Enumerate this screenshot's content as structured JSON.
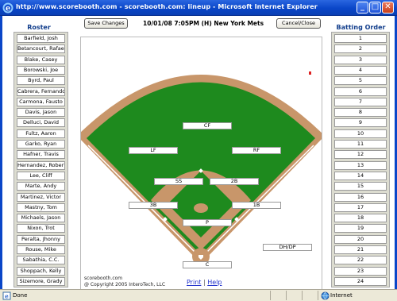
{
  "window": {
    "title": "http://www.scorebooth.com - scorebooth.com: lineup - Microsoft Internet Explorer",
    "min_glyph": "_",
    "max_glyph": "□",
    "close_glyph": "✕"
  },
  "toolbar": {
    "save_label": "Save Changes",
    "game_info": "10/01/08 7:05PM (H) New York Mets",
    "cancel_label": "Cancel/Close"
  },
  "roster": {
    "header": "Roster",
    "players": [
      "Barfield, Josh",
      "Betancourt, Rafael",
      "Blake, Casey",
      "Borowski, Joe",
      "Byrd, Paul",
      "Cabrera, Fernando",
      "Carmona, Fausto",
      "Davis, Jason",
      "Delluci, David",
      "Fultz, Aaron",
      "Garko, Ryan",
      "Hafner, Travis",
      "Hernandez, Roberto",
      "Lee, Cliff",
      "Marte, Andy",
      "Martinez, Victor",
      "Mastny, Tom",
      "Michaels, Jason",
      "Nixon, Trot",
      "Peralta, Jhonny",
      "Rouse, Mike",
      "Sabathia, C.C.",
      "Shoppach, Kelly",
      "Sizemore, Grady"
    ]
  },
  "batting_order": {
    "header": "Batting Order",
    "slots": [
      "1",
      "2",
      "3",
      "4",
      "5",
      "6",
      "7",
      "8",
      "9",
      "10",
      "11",
      "12",
      "13",
      "14",
      "15",
      "16",
      "17",
      "18",
      "19",
      "20",
      "21",
      "22",
      "23",
      "24"
    ]
  },
  "field": {
    "positions": {
      "cf": "CF",
      "lf": "LF",
      "rf": "RF",
      "ss": "SS",
      "b2": "2B",
      "b3": "3B",
      "b1": "1B",
      "p": "P",
      "c": "C",
      "dh": "DH/DP"
    },
    "credit_line1": "scorebooth.com",
    "credit_line2": "@ Copyright 2005 InteroTech, LLC"
  },
  "links": {
    "print": "Print",
    "sep": "|",
    "help": "Help"
  },
  "status": {
    "left": "Done",
    "right": "Internet"
  },
  "colors": {
    "grass": "#1e8a1e",
    "dirt": "#c8966a",
    "titlebar": "#0a46c8"
  }
}
